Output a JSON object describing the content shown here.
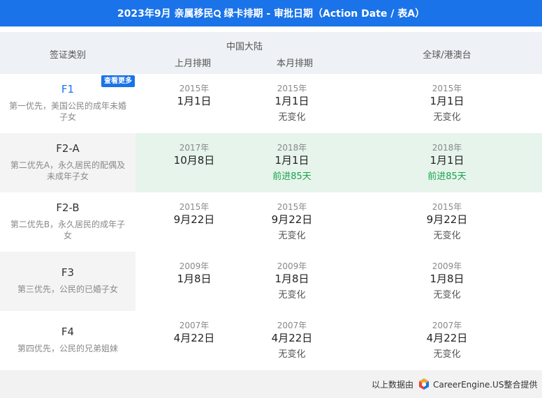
{
  "title": {
    "part1": "2023年9月 亲属移民",
    "search_icon": "magnifier-icon",
    "part2": "绿卡排期 - 审批日期（Action Date / 表A）"
  },
  "header": {
    "category": "签证类别",
    "mainland": "中国大陆",
    "last_month": "上月排期",
    "this_month": "本月排期",
    "global": "全球/港澳台"
  },
  "rows": [
    {
      "code": "F1",
      "badge": "查看更多",
      "desc": "第一优先，美国公民的成年未婚子女",
      "last": {
        "year": "2015年",
        "md": "1月1日"
      },
      "curr": {
        "year": "2015年",
        "md": "1月1日",
        "change": "无变化"
      },
      "global": {
        "year": "2015年",
        "md": "1月1日",
        "change": "无变化"
      }
    },
    {
      "code": "F2-A",
      "desc": "第二优先A，永久居民的配偶及未成年子女",
      "last": {
        "year": "2017年",
        "md": "10月8日"
      },
      "curr": {
        "year": "2018年",
        "md": "1月1日",
        "change": "前进85天"
      },
      "global": {
        "year": "2018年",
        "md": "1月1日",
        "change": "前进85天"
      }
    },
    {
      "code": "F2-B",
      "desc": "第二优先B，永久居民的成年子女",
      "last": {
        "year": "2015年",
        "md": "9月22日"
      },
      "curr": {
        "year": "2015年",
        "md": "9月22日",
        "change": "无变化"
      },
      "global": {
        "year": "2015年",
        "md": "9月22日",
        "change": "无变化"
      }
    },
    {
      "code": "F3",
      "desc": "第三优先，公民的已婚子女",
      "last": {
        "year": "2009年",
        "md": "1月8日"
      },
      "curr": {
        "year": "2009年",
        "md": "1月8日",
        "change": "无变化"
      },
      "global": {
        "year": "2009年",
        "md": "1月8日",
        "change": "无变化"
      }
    },
    {
      "code": "F4",
      "desc": "第四优先，公民的兄弟姐妹",
      "last": {
        "year": "2007年",
        "md": "4月22日"
      },
      "curr": {
        "year": "2007年",
        "md": "4月22日",
        "change": "无变化"
      },
      "global": {
        "year": "2007年",
        "md": "4月22日",
        "change": "无变化"
      }
    }
  ],
  "footer": {
    "source_label": "以上数据由",
    "logo_icon": "careerengine-logo-icon",
    "brand": "CareerEngine.US整合提供"
  },
  "colors": {
    "primary": "#1a73e8",
    "advance": "#1aa34a",
    "highlight_row": "#e6f4ec"
  }
}
